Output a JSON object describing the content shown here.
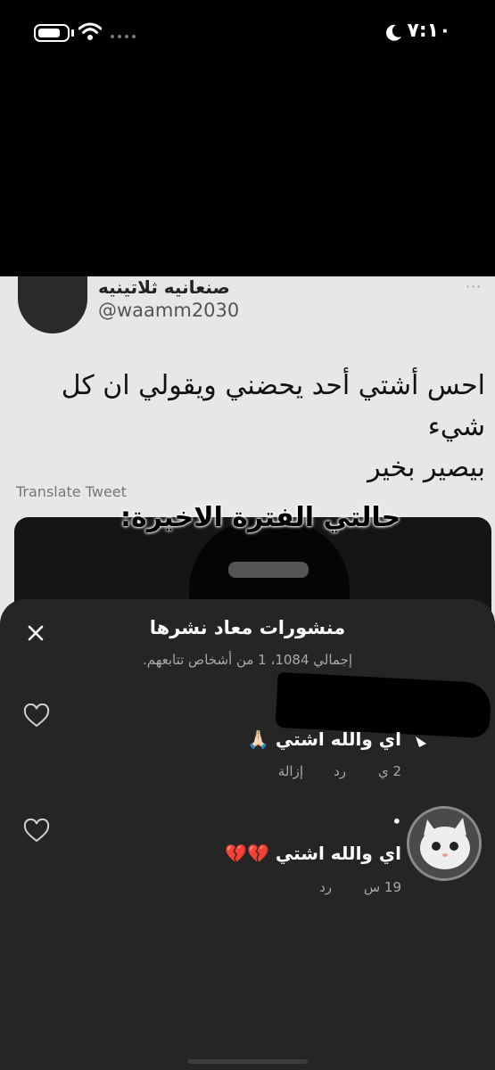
{
  "status_bar": {
    "time": "٧:١٠"
  },
  "tweet": {
    "author_name": "صنعانيه ثلاتينيه",
    "handle": "@waamm2030",
    "more": "···",
    "text_line1": "احس أشتي أحد يحضني ويقولي ان كل شيء",
    "text_line2": "بيصير بخير",
    "translate_label": "Translate Tweet",
    "media_caption": "حالتي الفترة الاخيرة:"
  },
  "sheet": {
    "title": "منشورات معاد نشرها",
    "subtitle": "إجمالي 1084، 1 من أشخاص تتابعهم.",
    "comments": [
      {
        "text": "اي والله اشتي 🙏🏻",
        "time": "2 ي",
        "reply_label": "رد",
        "remove_label": "إزالة"
      },
      {
        "dot": "•",
        "text": "اي والله اشتي 💔💔",
        "time": "19 س",
        "reply_label": "رد"
      }
    ]
  },
  "colors": {
    "sheet_bg": "#252526",
    "secondary_text": "#a8a8a8",
    "tweet_bg": "#e7e7e7"
  },
  "icons": [
    "battery-icon",
    "wifi-icon",
    "signal-dots-icon",
    "moon-icon",
    "close-icon",
    "heart-icon"
  ]
}
